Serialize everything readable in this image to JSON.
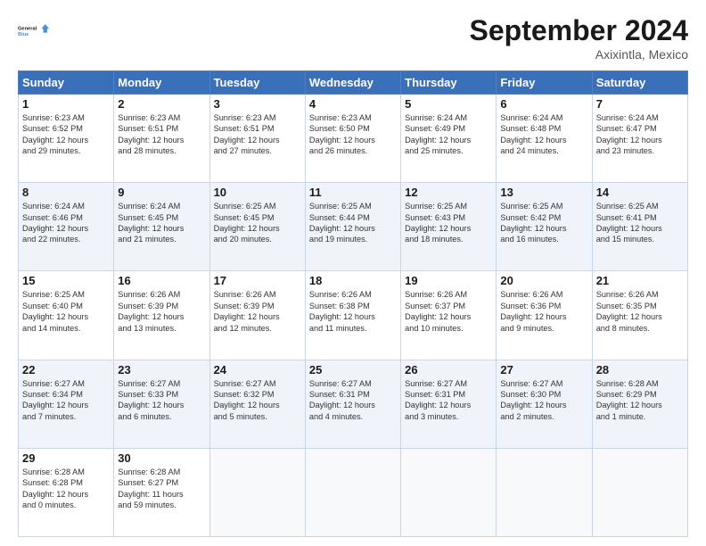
{
  "logo": {
    "line1": "General",
    "line2": "Blue"
  },
  "title": "September 2024",
  "location": "Axixintla, Mexico",
  "days_header": [
    "Sunday",
    "Monday",
    "Tuesday",
    "Wednesday",
    "Thursday",
    "Friday",
    "Saturday"
  ],
  "weeks": [
    [
      {
        "day": "1",
        "info": "Sunrise: 6:23 AM\nSunset: 6:52 PM\nDaylight: 12 hours\nand 29 minutes."
      },
      {
        "day": "2",
        "info": "Sunrise: 6:23 AM\nSunset: 6:51 PM\nDaylight: 12 hours\nand 28 minutes."
      },
      {
        "day": "3",
        "info": "Sunrise: 6:23 AM\nSunset: 6:51 PM\nDaylight: 12 hours\nand 27 minutes."
      },
      {
        "day": "4",
        "info": "Sunrise: 6:23 AM\nSunset: 6:50 PM\nDaylight: 12 hours\nand 26 minutes."
      },
      {
        "day": "5",
        "info": "Sunrise: 6:24 AM\nSunset: 6:49 PM\nDaylight: 12 hours\nand 25 minutes."
      },
      {
        "day": "6",
        "info": "Sunrise: 6:24 AM\nSunset: 6:48 PM\nDaylight: 12 hours\nand 24 minutes."
      },
      {
        "day": "7",
        "info": "Sunrise: 6:24 AM\nSunset: 6:47 PM\nDaylight: 12 hours\nand 23 minutes."
      }
    ],
    [
      {
        "day": "8",
        "info": "Sunrise: 6:24 AM\nSunset: 6:46 PM\nDaylight: 12 hours\nand 22 minutes."
      },
      {
        "day": "9",
        "info": "Sunrise: 6:24 AM\nSunset: 6:45 PM\nDaylight: 12 hours\nand 21 minutes."
      },
      {
        "day": "10",
        "info": "Sunrise: 6:25 AM\nSunset: 6:45 PM\nDaylight: 12 hours\nand 20 minutes."
      },
      {
        "day": "11",
        "info": "Sunrise: 6:25 AM\nSunset: 6:44 PM\nDaylight: 12 hours\nand 19 minutes."
      },
      {
        "day": "12",
        "info": "Sunrise: 6:25 AM\nSunset: 6:43 PM\nDaylight: 12 hours\nand 18 minutes."
      },
      {
        "day": "13",
        "info": "Sunrise: 6:25 AM\nSunset: 6:42 PM\nDaylight: 12 hours\nand 16 minutes."
      },
      {
        "day": "14",
        "info": "Sunrise: 6:25 AM\nSunset: 6:41 PM\nDaylight: 12 hours\nand 15 minutes."
      }
    ],
    [
      {
        "day": "15",
        "info": "Sunrise: 6:25 AM\nSunset: 6:40 PM\nDaylight: 12 hours\nand 14 minutes."
      },
      {
        "day": "16",
        "info": "Sunrise: 6:26 AM\nSunset: 6:39 PM\nDaylight: 12 hours\nand 13 minutes."
      },
      {
        "day": "17",
        "info": "Sunrise: 6:26 AM\nSunset: 6:39 PM\nDaylight: 12 hours\nand 12 minutes."
      },
      {
        "day": "18",
        "info": "Sunrise: 6:26 AM\nSunset: 6:38 PM\nDaylight: 12 hours\nand 11 minutes."
      },
      {
        "day": "19",
        "info": "Sunrise: 6:26 AM\nSunset: 6:37 PM\nDaylight: 12 hours\nand 10 minutes."
      },
      {
        "day": "20",
        "info": "Sunrise: 6:26 AM\nSunset: 6:36 PM\nDaylight: 12 hours\nand 9 minutes."
      },
      {
        "day": "21",
        "info": "Sunrise: 6:26 AM\nSunset: 6:35 PM\nDaylight: 12 hours\nand 8 minutes."
      }
    ],
    [
      {
        "day": "22",
        "info": "Sunrise: 6:27 AM\nSunset: 6:34 PM\nDaylight: 12 hours\nand 7 minutes."
      },
      {
        "day": "23",
        "info": "Sunrise: 6:27 AM\nSunset: 6:33 PM\nDaylight: 12 hours\nand 6 minutes."
      },
      {
        "day": "24",
        "info": "Sunrise: 6:27 AM\nSunset: 6:32 PM\nDaylight: 12 hours\nand 5 minutes."
      },
      {
        "day": "25",
        "info": "Sunrise: 6:27 AM\nSunset: 6:31 PM\nDaylight: 12 hours\nand 4 minutes."
      },
      {
        "day": "26",
        "info": "Sunrise: 6:27 AM\nSunset: 6:31 PM\nDaylight: 12 hours\nand 3 minutes."
      },
      {
        "day": "27",
        "info": "Sunrise: 6:27 AM\nSunset: 6:30 PM\nDaylight: 12 hours\nand 2 minutes."
      },
      {
        "day": "28",
        "info": "Sunrise: 6:28 AM\nSunset: 6:29 PM\nDaylight: 12 hours\nand 1 minute."
      }
    ],
    [
      {
        "day": "29",
        "info": "Sunrise: 6:28 AM\nSunset: 6:28 PM\nDaylight: 12 hours\nand 0 minutes."
      },
      {
        "day": "30",
        "info": "Sunrise: 6:28 AM\nSunset: 6:27 PM\nDaylight: 11 hours\nand 59 minutes."
      },
      {
        "day": "",
        "info": ""
      },
      {
        "day": "",
        "info": ""
      },
      {
        "day": "",
        "info": ""
      },
      {
        "day": "",
        "info": ""
      },
      {
        "day": "",
        "info": ""
      }
    ]
  ]
}
